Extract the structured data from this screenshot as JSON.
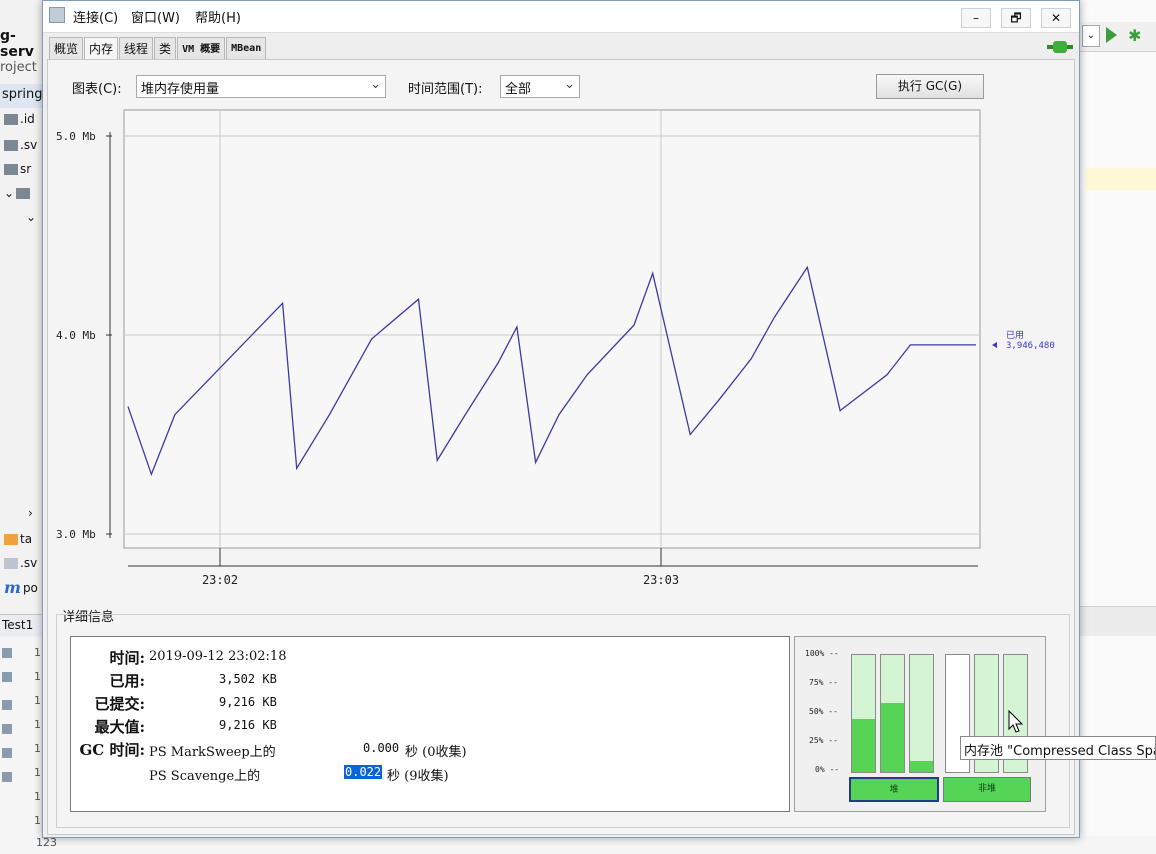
{
  "ide": {
    "project_title": "g-serv",
    "project_label": "roject",
    "tree_selected": "spring",
    "tree_items": [
      ".id",
      ".sv",
      "sr",
      "ta",
      ".sv",
      "po"
    ],
    "test_tab": "Test1",
    "gutter_numbers": [
      "1",
      "1",
      "1",
      "1",
      "1",
      "1",
      "1",
      "1",
      "1"
    ],
    "bottom_line": "123",
    "colors": {
      "run": "#3c9d3c",
      "highlight": "#fff8d6"
    }
  },
  "window": {
    "menu": [
      "连接(C)",
      "窗口(W)",
      "帮助(H)"
    ],
    "controls": {
      "minimize": "–",
      "restore": "🗗",
      "close": "✕"
    },
    "tabs": [
      "概览",
      "内存",
      "线程",
      "类",
      "VM 概要",
      "MBean"
    ],
    "active_tab": "内存"
  },
  "toolbar": {
    "chart_label": "图表(C):",
    "chart_value": "堆内存使用量",
    "range_label": "时间范围(T):",
    "range_value": "全部",
    "gc_button": "执行 GC(G)"
  },
  "chart_data": {
    "type": "line",
    "title": "",
    "xlabel": "",
    "ylabel": "",
    "ylim": [
      3.0,
      5.0
    ],
    "yticks": [
      "5.0 Mb",
      "4.0 Mb",
      "3.0 Mb"
    ],
    "xticks": [
      "23:02",
      "23:03"
    ],
    "series": [
      {
        "name": "已用",
        "color": "#3a3aa8",
        "x": [
          0,
          0.5,
          1,
          3.3,
          3.6,
          4.3,
          5.2,
          6.2,
          6.6,
          7.2,
          7.9,
          8.3,
          8.7,
          9.2,
          9.8,
          10.8,
          11.2,
          12.0,
          12.6,
          13.3,
          13.8,
          14.5,
          15.2,
          16.2,
          16.7,
          17.5,
          18.1
        ],
        "values": [
          3.64,
          3.3,
          3.6,
          4.16,
          3.33,
          3.6,
          3.98,
          4.18,
          3.37,
          3.6,
          3.86,
          4.04,
          3.36,
          3.6,
          3.8,
          4.05,
          4.31,
          3.5,
          3.67,
          3.88,
          4.09,
          4.34,
          3.62,
          3.8,
          3.95,
          3.95,
          3.95
        ]
      }
    ],
    "current_value_label": "已用",
    "current_value": "3,946,480",
    "grid": true
  },
  "details": {
    "title": "详细信息",
    "time_label": "时间:",
    "time_value": "2019-09-12 23:02:18",
    "used_label": "已用:",
    "used_value": "3,502 KB",
    "committed_label": "已提交:",
    "committed_value": "9,216 KB",
    "max_label": "最大值:",
    "max_value": "9,216 KB",
    "gc_label": "GC 时间:",
    "gc1_name": "PS MarkSweep上的",
    "gc1_time": "0.000",
    "gc1_unit": "秒 (0收集)",
    "gc2_name": "PS Scavenge上的",
    "gc2_time": "0.022",
    "gc2_unit": "秒 (9收集)"
  },
  "pools": {
    "percent_ticks": [
      "100% --",
      "75% --",
      "50% --",
      "25% --",
      "0% --"
    ],
    "heap_bars": [
      0.45,
      0.59,
      0.09
    ],
    "nonheap_bars": [
      0.0,
      0.0,
      0.0
    ],
    "heap_button": "堆",
    "nonheap_button": "非堆",
    "tooltip": "内存池 \"Compressed Class Space\""
  }
}
